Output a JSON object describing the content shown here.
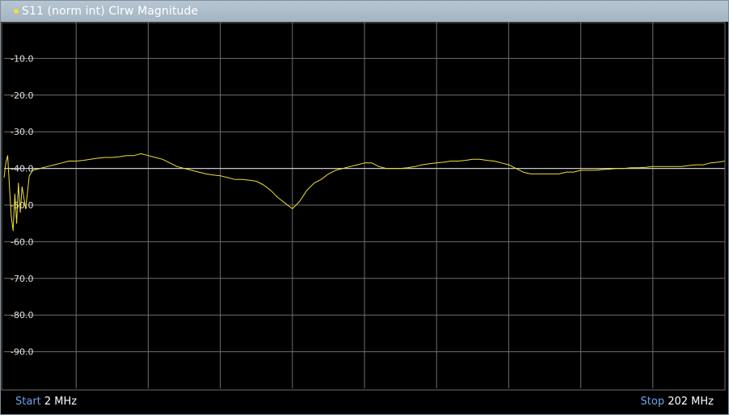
{
  "window": {
    "title": "S11 (norm int) Clrw Magnitude"
  },
  "footer": {
    "start_label": "Start",
    "start_value": "2 MHz",
    "stop_label": "Stop",
    "stop_value": "202 MHz"
  },
  "colors": {
    "trace": "#f2de3a",
    "grid": "#6e6e6e",
    "reference_line": "#c8c8c8",
    "background": "#000000",
    "keyword": "#6aa6e8"
  },
  "chart_data": {
    "type": "line",
    "title": "S11 (norm int) Clrw Magnitude",
    "xlim": [
      2,
      202
    ],
    "ylim": [
      -100,
      0
    ],
    "y_ticks": [
      -10,
      -20,
      -30,
      -40,
      -50,
      -60,
      -70,
      -80,
      -90
    ],
    "y_tick_labels": [
      "-10.0",
      "-20.0",
      "-30.0",
      "-40.0",
      "-50.0",
      "-60.0",
      "-70.0",
      "-80.0",
      "-90.0"
    ],
    "reference_level": -40,
    "grid": true,
    "series": [
      {
        "x": [
          2,
          2.5,
          3,
          3.5,
          4,
          4.5,
          5,
          5.5,
          6,
          6.5,
          7,
          8,
          9,
          10,
          12,
          14,
          16,
          18,
          20,
          22,
          24,
          26,
          28,
          30,
          32,
          34,
          36,
          38,
          40,
          42,
          44,
          46,
          48,
          50,
          52,
          54,
          56,
          58,
          60,
          62,
          64,
          66,
          68,
          70,
          72,
          74,
          76,
          78,
          80,
          82,
          84,
          86,
          88,
          90,
          92,
          94,
          96,
          98,
          100,
          102,
          104,
          106,
          108,
          110,
          112,
          114,
          116,
          118,
          120,
          122,
          124,
          126,
          128,
          130,
          132,
          134,
          136,
          138,
          140,
          142,
          144,
          146,
          148,
          150,
          152,
          154,
          156,
          158,
          160,
          162,
          164,
          166,
          168,
          170,
          172,
          174,
          176,
          178,
          180,
          182,
          184,
          186,
          188,
          190,
          192,
          194,
          196,
          198,
          200,
          202
        ],
        "y": [
          -42.5,
          -38.5,
          -36.5,
          -45,
          -53,
          -57,
          -47,
          -55,
          -44,
          -52,
          -45,
          -51,
          -42,
          -40.5,
          -40,
          -39.5,
          -39,
          -38.5,
          -38,
          -38,
          -37.8,
          -37.5,
          -37.2,
          -37,
          -37,
          -36.8,
          -36.5,
          -36.5,
          -36,
          -36.5,
          -37,
          -37.5,
          -38.5,
          -39.5,
          -40,
          -40.5,
          -41,
          -41.5,
          -41.8,
          -42,
          -42.5,
          -43,
          -43,
          -43.2,
          -43.5,
          -44.5,
          -46,
          -48,
          -49.5,
          -51,
          -49,
          -46,
          -44,
          -43,
          -41.5,
          -40.5,
          -40,
          -39.5,
          -39,
          -38.5,
          -38.5,
          -39.5,
          -40,
          -40,
          -40,
          -39.8,
          -39.5,
          -39,
          -38.7,
          -38.5,
          -38.3,
          -38,
          -38,
          -37.8,
          -37.5,
          -37.5,
          -37.8,
          -38,
          -38.5,
          -39,
          -40,
          -41,
          -41.5,
          -41.5,
          -41.5,
          -41.5,
          -41.5,
          -41,
          -41,
          -40.5,
          -40.5,
          -40.5,
          -40.3,
          -40.2,
          -40,
          -40,
          -39.8,
          -39.8,
          -39.7,
          -39.5,
          -39.5,
          -39.5,
          -39.5,
          -39.5,
          -39.2,
          -39,
          -39,
          -38.5,
          -38.3,
          -38
        ]
      }
    ]
  }
}
